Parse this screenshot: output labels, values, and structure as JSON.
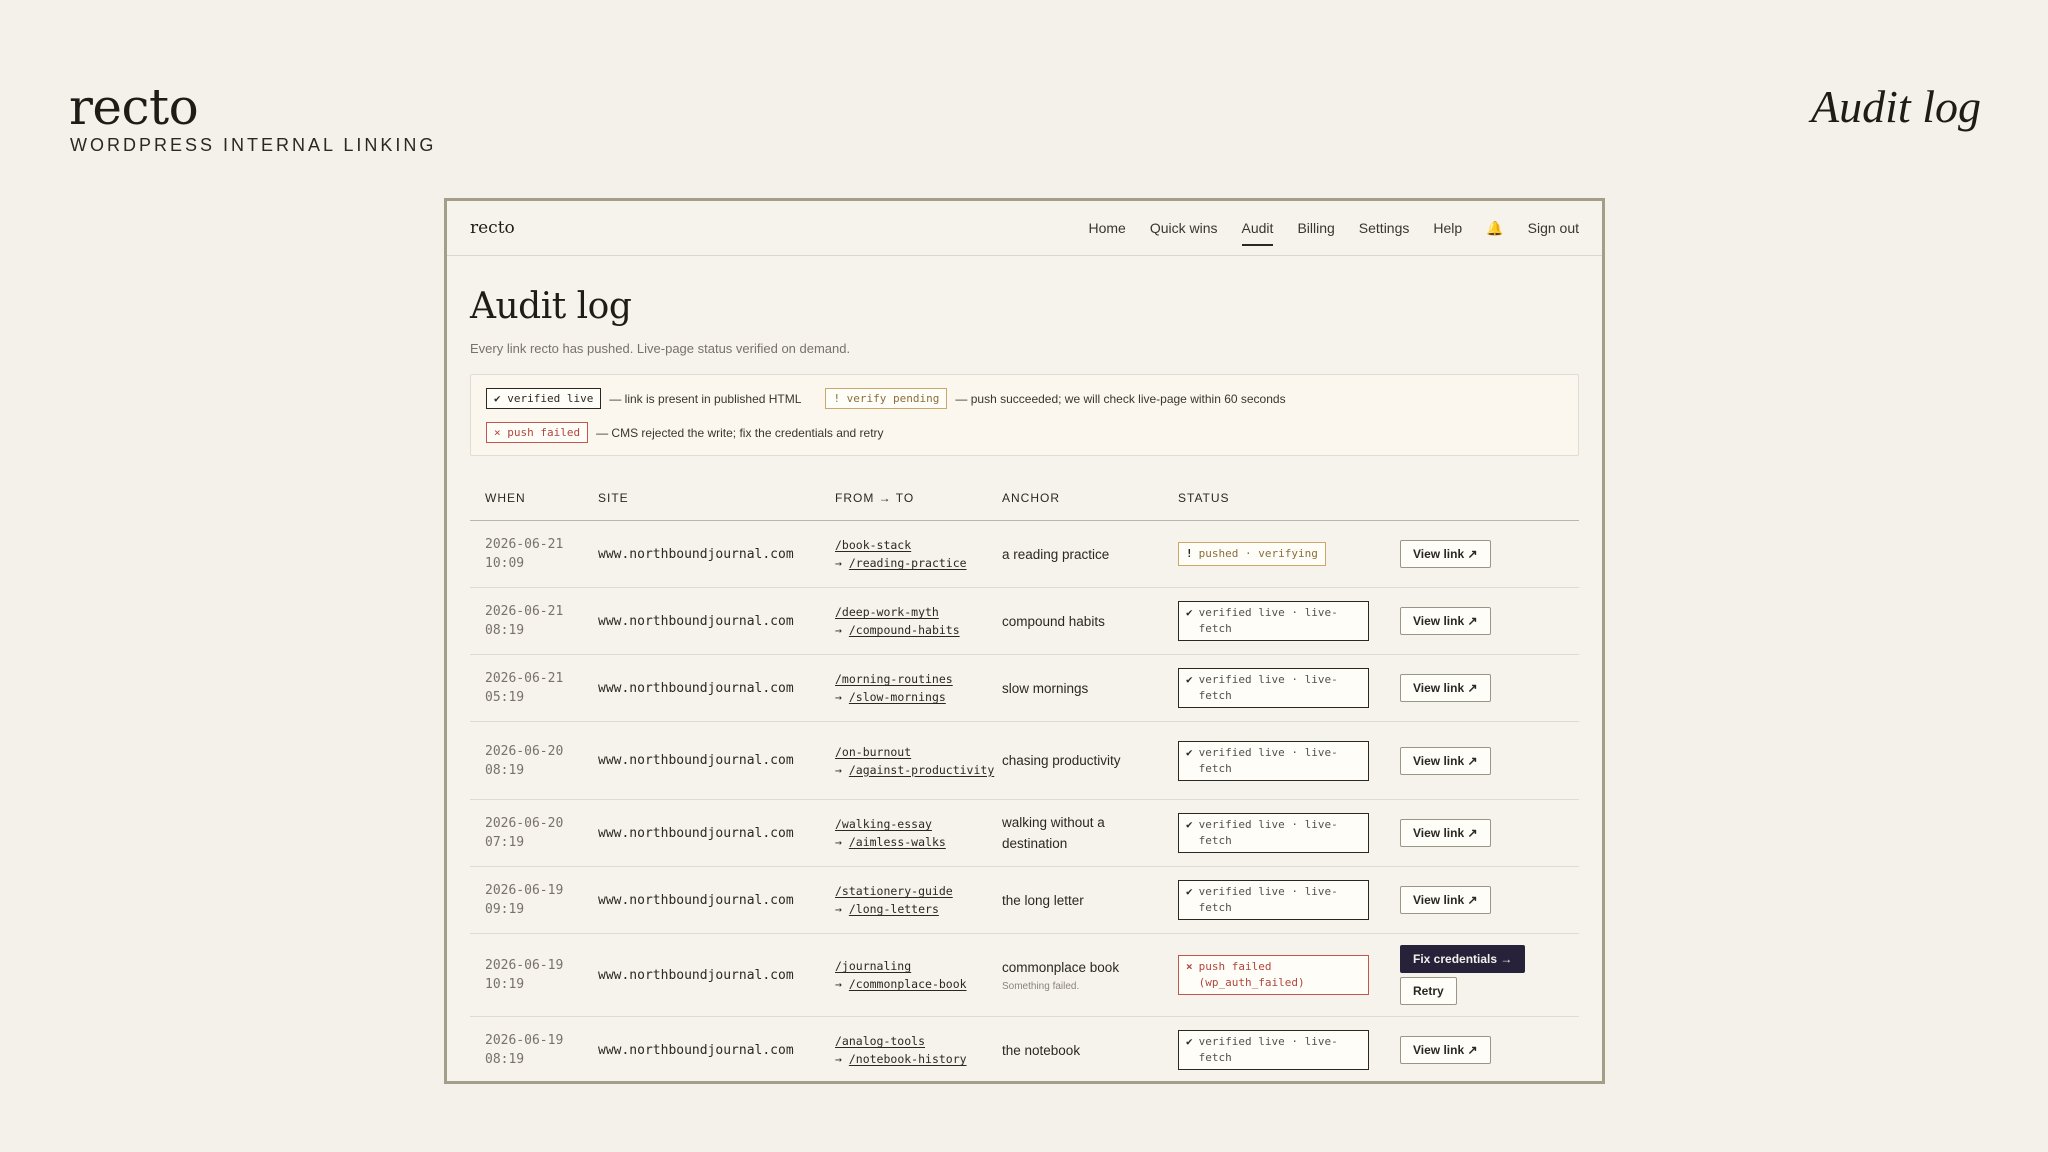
{
  "brand": {
    "name": "recto",
    "tagline": "WORDPRESS INTERNAL LINKING",
    "corner_title": "Audit log"
  },
  "app": {
    "logo": "recto",
    "nav": [
      {
        "label": "Home",
        "active": false
      },
      {
        "label": "Quick wins",
        "active": false
      },
      {
        "label": "Audit",
        "active": true
      },
      {
        "label": "Billing",
        "active": false
      },
      {
        "label": "Settings",
        "active": false
      },
      {
        "label": "Help",
        "active": false
      }
    ],
    "bell_icon": "🔔",
    "sign_out": "Sign out"
  },
  "page": {
    "title": "Audit log",
    "subtitle": "Every link recto has pushed. Live-page status verified on demand."
  },
  "legend": {
    "live_badge": "✔ verified live",
    "live_desc": "— link is present in published HTML",
    "pending_badge": "! verify pending",
    "pending_desc": "— push succeeded; we will check live-page within 60 seconds",
    "failed_badge": "× push failed",
    "failed_desc": "— CMS rejected the write; fix the credentials and retry"
  },
  "table": {
    "headers": {
      "when": "WHEN",
      "site": "SITE",
      "fromto": "FROM → TO",
      "anchor": "ANCHOR",
      "status": "STATUS"
    },
    "rows": [
      {
        "date": "2026-06-21",
        "time": "10:09",
        "site": "www.northboundjournal.com",
        "from": "/book-stack",
        "to": "/reading-practice",
        "anchor": "a reading practice",
        "note": "",
        "status_kind": "pending",
        "status_mark": "!",
        "status_text": "pushed · verifying",
        "action": "View link ↗",
        "action2": ""
      },
      {
        "date": "2026-06-21",
        "time": "08:19",
        "site": "www.northboundjournal.com",
        "from": "/deep-work-myth",
        "to": "/compound-habits",
        "anchor": "compound habits",
        "note": "",
        "status_kind": "live",
        "status_mark": "✔",
        "status_text": "verified live · live-fetch",
        "action": "View link ↗",
        "action2": ""
      },
      {
        "date": "2026-06-21",
        "time": "05:19",
        "site": "www.northboundjournal.com",
        "from": "/morning-routines",
        "to": "/slow-mornings",
        "anchor": "slow mornings",
        "note": "",
        "status_kind": "live",
        "status_mark": "✔",
        "status_text": "verified live · live-fetch",
        "action": "View link ↗",
        "action2": ""
      },
      {
        "date": "2026-06-20",
        "time": "08:19",
        "site": "www.northboundjournal.com",
        "from": "/on-burnout",
        "to": "/against-productivity",
        "anchor": "chasing productivity",
        "note": "",
        "status_kind": "live",
        "status_mark": "✔",
        "status_text": "verified live · live-fetch",
        "action": "View link ↗",
        "action2": ""
      },
      {
        "date": "2026-06-20",
        "time": "07:19",
        "site": "www.northboundjournal.com",
        "from": "/walking-essay",
        "to": "/aimless-walks",
        "anchor": "walking without a destination",
        "note": "",
        "status_kind": "live",
        "status_mark": "✔",
        "status_text": "verified live · live-fetch",
        "action": "View link ↗",
        "action2": ""
      },
      {
        "date": "2026-06-19",
        "time": "09:19",
        "site": "www.northboundjournal.com",
        "from": "/stationery-guide",
        "to": "/long-letters",
        "anchor": "the long letter",
        "note": "",
        "status_kind": "live",
        "status_mark": "✔",
        "status_text": "verified live · live-fetch",
        "action": "View link ↗",
        "action2": ""
      },
      {
        "date": "2026-06-19",
        "time": "10:19",
        "site": "www.northboundjournal.com",
        "from": "/journaling",
        "to": "/commonplace-book",
        "anchor": "commonplace book",
        "note": "Something failed.",
        "status_kind": "failed",
        "status_mark": "×",
        "status_text": "push failed (wp_auth_failed)",
        "action": "Fix credentials →",
        "action2": "Retry"
      },
      {
        "date": "2026-06-19",
        "time": "08:19",
        "site": "www.northboundjournal.com",
        "from": "/analog-tools",
        "to": "/notebook-history",
        "anchor": "the notebook",
        "note": "",
        "status_kind": "live",
        "status_mark": "✔",
        "status_text": "verified live · live-fetch",
        "action": "View link ↗",
        "action2": ""
      }
    ]
  }
}
